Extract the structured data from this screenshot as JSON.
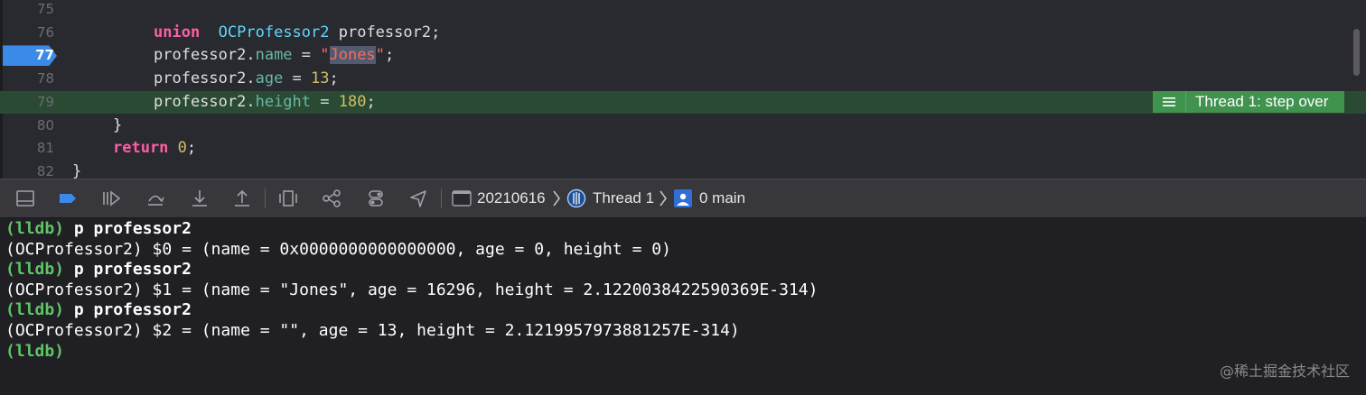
{
  "editor": {
    "lines": [
      {
        "num": "75",
        "parts": []
      },
      {
        "num": "76",
        "parts": [
          [
            "kw",
            "union"
          ],
          [
            "",
            "  "
          ],
          [
            "tyref",
            "OCProfessor2"
          ],
          [
            "",
            " professor2;"
          ]
        ]
      },
      {
        "num": "77",
        "parts": [
          [
            "",
            "professor2."
          ],
          [
            "prop",
            "name"
          ],
          [
            "",
            " = "
          ],
          [
            "str",
            "\""
          ],
          [
            "strsel",
            "Jones"
          ],
          [
            "str",
            "\""
          ],
          [
            "",
            ";"
          ]
        ]
      },
      {
        "num": "78",
        "parts": [
          [
            "",
            "professor2."
          ],
          [
            "prop",
            "age"
          ],
          [
            "",
            " = "
          ],
          [
            "num",
            "13"
          ],
          [
            "",
            ";"
          ]
        ]
      },
      {
        "num": "79",
        "parts": [
          [
            "",
            "professor2."
          ],
          [
            "prop",
            "height"
          ],
          [
            "",
            " = "
          ],
          [
            "num",
            "180"
          ],
          [
            "",
            ";"
          ]
        ]
      },
      {
        "num": "80",
        "parts": [
          [
            "",
            "}"
          ]
        ]
      },
      {
        "num": "81",
        "parts": [
          [
            "kw",
            "return"
          ],
          [
            "",
            " "
          ],
          [
            "num",
            "0"
          ],
          [
            "",
            ";"
          ]
        ]
      },
      {
        "num": "82",
        "parts": [
          [
            "",
            "}"
          ]
        ]
      }
    ],
    "breakpoint_line": "77",
    "thread_badge": "Thread 1: step over"
  },
  "toolbar": {
    "target": "20210616",
    "thread": "Thread 1",
    "frame": "0 main"
  },
  "console": {
    "lines": [
      {
        "prompt": "(lldb)",
        "text": " p professor2",
        "type": "cmd"
      },
      {
        "prompt": "",
        "text": "(OCProfessor2) $0 = (name = 0x0000000000000000, age = 0, height = 0)",
        "type": "out"
      },
      {
        "prompt": "(lldb)",
        "text": " p professor2",
        "type": "cmd"
      },
      {
        "prompt": "",
        "text": "(OCProfessor2) $1 = (name = \"Jones\", age = 16296, height = 2.1220038422590369E-314)",
        "type": "out"
      },
      {
        "prompt": "(lldb)",
        "text": " p professor2",
        "type": "cmd"
      },
      {
        "prompt": "",
        "text": "(OCProfessor2) $2 = (name = \"\", age = 13, height = 2.1219957973881257E-314)",
        "type": "out"
      },
      {
        "prompt": "(lldb)",
        "text": "",
        "type": "cmd"
      }
    ]
  },
  "watermark": "@稀土掘金技术社区",
  "colors": {
    "breakpoint": "#3c8ae8",
    "current_line": "#2b4a33",
    "badge": "#40934f",
    "prompt": "#5fc466"
  }
}
